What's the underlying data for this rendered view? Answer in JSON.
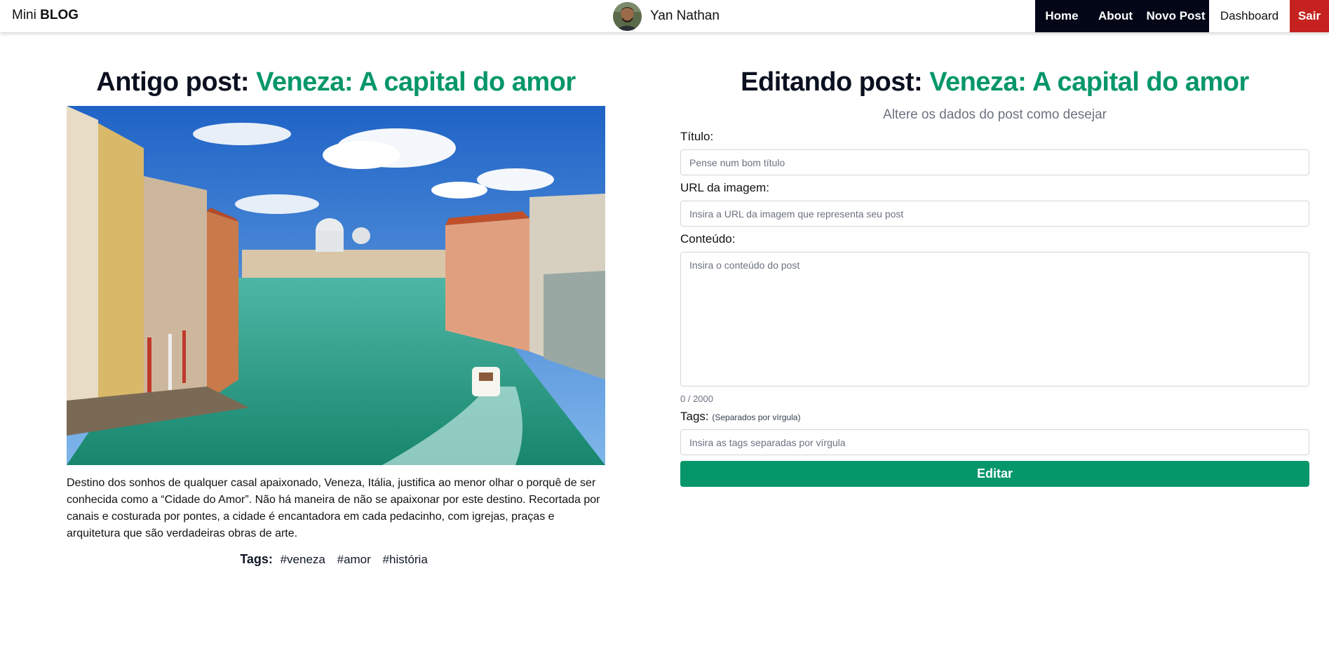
{
  "navbar": {
    "brand_prefix": "Mini",
    "brand_bold": "BLOG",
    "user_name": "Yan Nathan",
    "links": {
      "home": "Home",
      "about": "About",
      "new_post": "Novo Post",
      "dashboard": "Dashboard",
      "logout": "Sair"
    }
  },
  "old_post": {
    "heading_prefix": "Antigo post:",
    "title": "Veneza: A capital do amor",
    "content": "Destino dos sonhos de qualquer casal apaixonado, Veneza, Itália, justifica ao menor olhar o porquê de ser conhecida como a “Cidade do Amor”. Não há maneira de não se apaixonar por este destino. Recortada por canais e costurada por pontes, a cidade é encantadora em cada pedacinho, com igrejas, praças e arquitetura que são verdadeiras obras de arte.",
    "tags_label": "Tags:",
    "tags": [
      "#veneza",
      "#amor",
      "#história"
    ]
  },
  "edit_form": {
    "heading_prefix": "Editando post:",
    "title": "Veneza: A capital do amor",
    "subtitle": "Altere os dados do post como desejar",
    "title_label": "Título:",
    "title_placeholder": "Pense num bom título",
    "image_label": "URL da imagem:",
    "image_placeholder": "Insira a URL da imagem que representa seu post",
    "content_label": "Conteúdo:",
    "content_placeholder": "Insira o conteúdo do post",
    "counter": "0 / 2000",
    "tags_label": "Tags:",
    "tags_hint": "(Separados por vírgula)",
    "tags_placeholder": "Insira as tags separadas por vírgula",
    "submit_label": "Editar"
  },
  "colors": {
    "accent": "#059669",
    "nav_dark": "#020617",
    "logout": "#c5221f"
  }
}
